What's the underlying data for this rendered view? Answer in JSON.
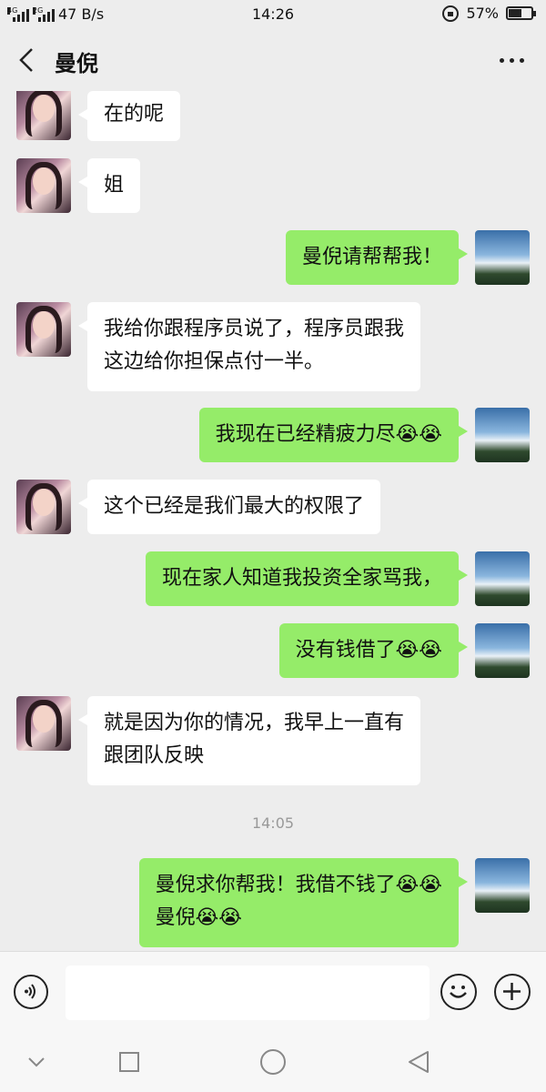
{
  "status_bar": {
    "net_left": "4G",
    "net_right": "2G",
    "speed": "47 B/s",
    "time": "14:26",
    "battery": "57%",
    "battery_level": 0.57
  },
  "header": {
    "title": "曼倪"
  },
  "messages": [
    {
      "from": "them",
      "lines": [
        "在的呢"
      ]
    },
    {
      "from": "them",
      "lines": [
        "姐"
      ]
    },
    {
      "from": "me",
      "lines": [
        "曼倪请帮帮我！"
      ]
    },
    {
      "from": "them",
      "lines": [
        "我给你跟程序员说了，程序员跟我",
        "这边给你担保点付一半。"
      ]
    },
    {
      "from": "me",
      "lines": [
        "我现在已经精疲力尽😭😭"
      ]
    },
    {
      "from": "them",
      "lines": [
        "这个已经是我们最大的权限了"
      ]
    },
    {
      "from": "me",
      "lines": [
        "现在家人知道我投资全家骂我，"
      ]
    },
    {
      "from": "me",
      "lines": [
        "没有钱借了😭😭"
      ]
    },
    {
      "from": "them",
      "lines": [
        "就是因为你的情况，我早上一直有",
        "跟团队反映"
      ]
    },
    {
      "from": "me",
      "lines": [
        "曼倪求你帮我！我借不钱了😭😭",
        "曼倪😭😭"
      ]
    }
  ],
  "timestamp": "14:05",
  "colors": {
    "sent_bubble": "#95ec69",
    "received_bubble": "#ffffff",
    "background": "#ededed"
  }
}
